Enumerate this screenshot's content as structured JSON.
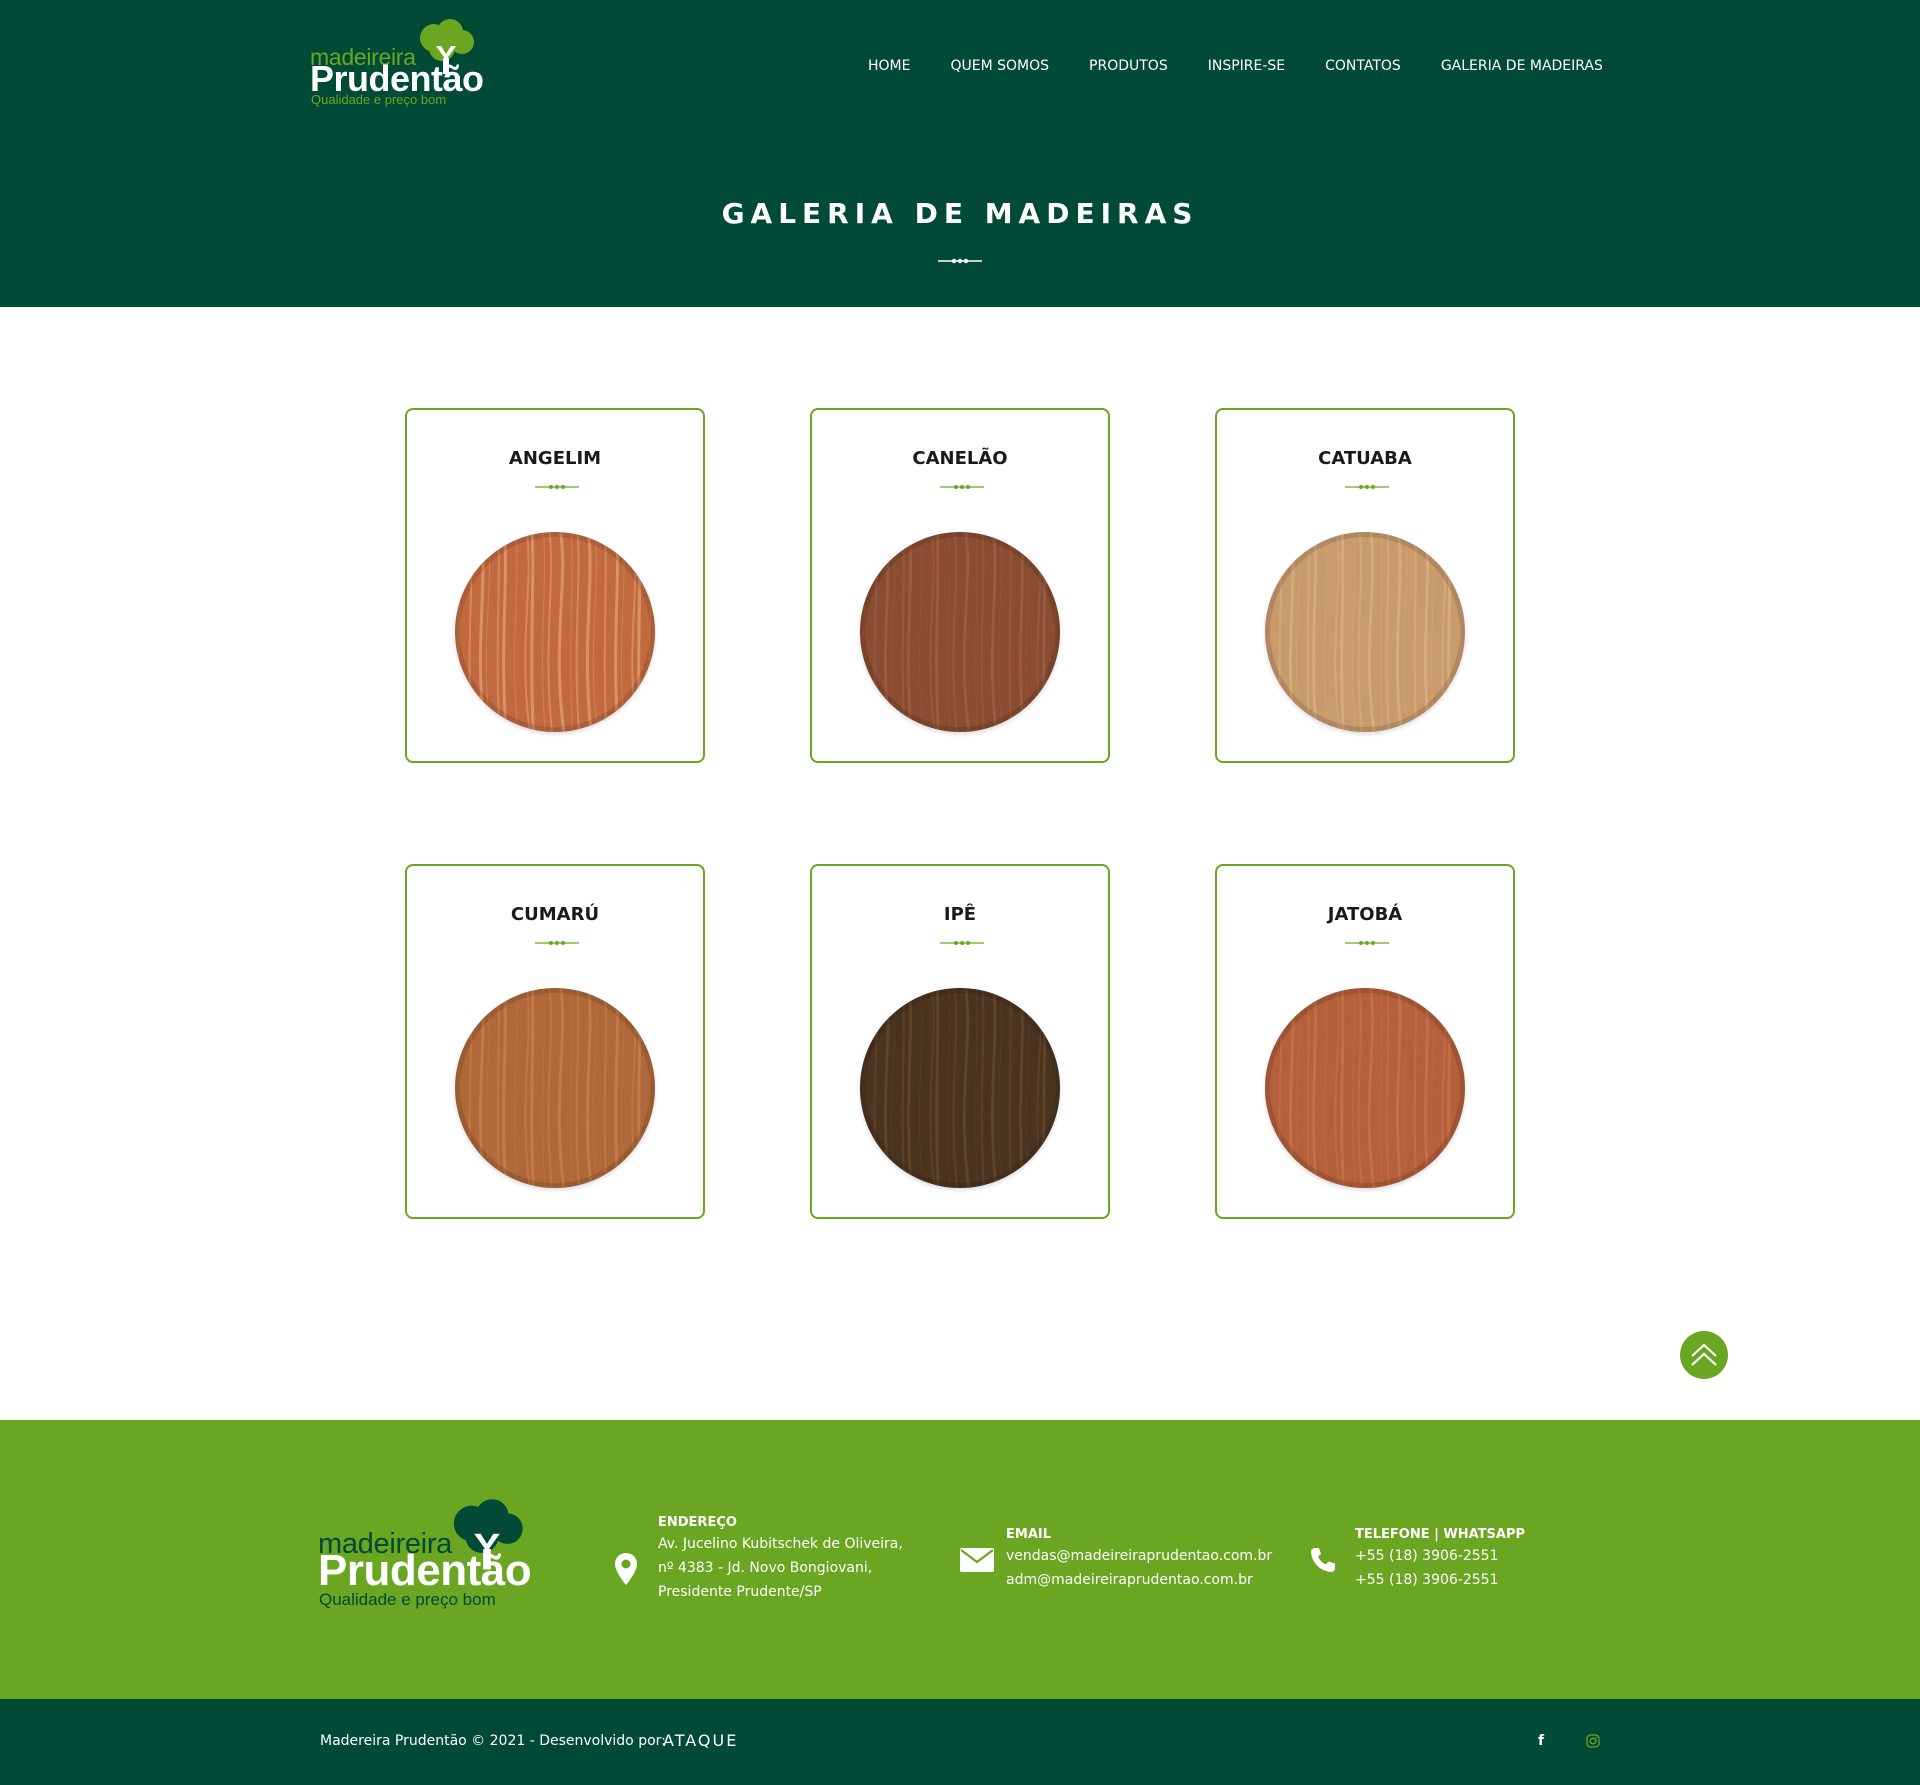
{
  "colors": {
    "dark_green": "#004a36",
    "light_green": "#6aa621",
    "white": "#ffffff"
  },
  "brand": {
    "logo_small": "madeireira",
    "logo_big": "Prudentão",
    "tagline": "Qualidade e preço bom"
  },
  "nav": {
    "items": [
      {
        "label": "HOME"
      },
      {
        "label": "QUEM SOMOS"
      },
      {
        "label": "PRODUTOS"
      },
      {
        "label": "INSPIRE-SE"
      },
      {
        "label": "CONTATOS"
      },
      {
        "label": "GALERIA DE MADEIRAS"
      }
    ]
  },
  "page": {
    "title": "GALERIA DE MADEIRAS"
  },
  "gallery": {
    "woods": [
      {
        "name": "ANGELIM",
        "base": "#c26a3f",
        "grain": "#e8a57a"
      },
      {
        "name": "CANELÃO",
        "base": "#8a4d32",
        "grain": "#a3624a"
      },
      {
        "name": "CATUABA",
        "base": "#c99a6b",
        "grain": "#dcb68c"
      },
      {
        "name": "CUMARÚ",
        "base": "#b0683a",
        "grain": "#c98652"
      },
      {
        "name": "IPÊ",
        "base": "#4a3420",
        "grain": "#6b4c2e"
      },
      {
        "name": "JATOBÁ",
        "base": "#b4603a",
        "grain": "#c87652"
      }
    ]
  },
  "footer": {
    "address": {
      "title": "ENDEREÇO",
      "line1": "Av. Jucelino Kubitschek de Oliveira,",
      "line2": "nº 4383 - Jd. Novo Bongiovani,",
      "line3": "Presidente Prudente/SP",
      "icon": "map-pin-icon"
    },
    "email": {
      "title": "EMAIL",
      "line1": "vendas@madeireiraprudentao.com.br",
      "line2": "adm@madeireiraprudentao.com.br",
      "icon": "envelope-icon"
    },
    "phone": {
      "title": "TELEFONE | WHATSAPP",
      "line1": "+55 (18) 3906-2551",
      "line2": "+55 (18) 3906-2551",
      "icon": "phone-icon"
    },
    "copyright": "Madereira Prudentão © 2021 - Desenvolvido por:",
    "developer": "ATAQUE",
    "social": {
      "facebook": "f",
      "instagram_icon": "instagram-icon"
    }
  }
}
